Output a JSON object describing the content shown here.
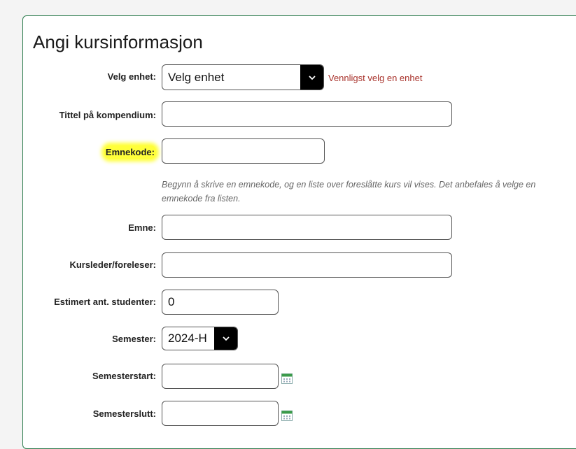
{
  "form": {
    "title": "Angi kursinformasjon",
    "unit": {
      "label": "Velg enhet:",
      "selected": "Velg enhet",
      "error": "Vennligst velg en enhet"
    },
    "compendium_title": {
      "label": "Tittel på kompendium:",
      "value": ""
    },
    "course_code": {
      "label": "Emnekode:",
      "value": "",
      "hint": "Begynn å skrive en emnekode, og en liste over foreslåtte kurs vil vises. Det anbefales å velge en emnekode fra listen."
    },
    "subject": {
      "label": "Emne:",
      "value": ""
    },
    "lecturer": {
      "label": "Kursleder/foreleser:",
      "value": ""
    },
    "students": {
      "label": "Estimert ant. studenter:",
      "value": "0"
    },
    "semester": {
      "label": "Semester:",
      "selected": "2024-H"
    },
    "semester_start": {
      "label": "Semesterstart:",
      "value": ""
    },
    "semester_end": {
      "label": "Semesterslutt:",
      "value": ""
    }
  },
  "icons": {
    "calendar": "calendar-icon",
    "dropdown": "chevron-down-icon"
  },
  "colors": {
    "panel_border": "#2e7d4f",
    "error": "#a8322b",
    "highlight": "#ffff3a",
    "calendar": "#3a9a4a"
  }
}
